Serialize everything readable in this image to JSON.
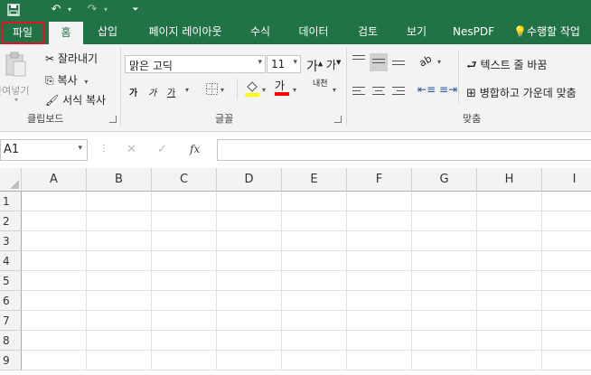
{
  "quick_access": {
    "save_icon": "save-icon",
    "undo_icon": "undo-icon",
    "redo_icon": "redo-icon",
    "customize_icon": "customize-qat-icon"
  },
  "tabs": [
    {
      "label": "파일"
    },
    {
      "label": "홈"
    },
    {
      "label": "삽입"
    },
    {
      "label": "페이지 레이아웃"
    },
    {
      "label": "수식"
    },
    {
      "label": "데이터"
    },
    {
      "label": "검토"
    },
    {
      "label": "보기"
    },
    {
      "label": "NesPDF"
    }
  ],
  "tell_me": "수행할 작업",
  "clipboard": {
    "paste": "붙여넣기",
    "cut": "잘라내기",
    "copy": "복사",
    "format_painter": "서식 복사",
    "group": "클립보드"
  },
  "font": {
    "name": "맑은 고딕",
    "size": "11",
    "bold": "가",
    "italic": "가",
    "underline": "가",
    "font_color": "가",
    "phonetic": "내천",
    "group": "글꼴",
    "grow_icon": "increase-font-size-icon",
    "shrink_icon": "decrease-font-size-icon"
  },
  "alignment": {
    "wrap_text": "텍스트 줄 바꿈",
    "merge_center": "병합하고 가운데 맞춤",
    "group": "맞춤"
  },
  "formula_bar": {
    "name_box": "A1",
    "fx": "fx",
    "cancel": "✕",
    "enter": "✓",
    "formula": ""
  },
  "sheet": {
    "columns": [
      "A",
      "B",
      "C",
      "D",
      "E",
      "F",
      "G",
      "H",
      "I"
    ],
    "rows": [
      "1",
      "2",
      "3",
      "4",
      "5",
      "6",
      "7",
      "8",
      "9"
    ]
  },
  "colors": {
    "excel_green": "#217346",
    "highlight_box": "#e81123",
    "fill_yellow": "#ffff00",
    "font_red": "#ff0000"
  }
}
